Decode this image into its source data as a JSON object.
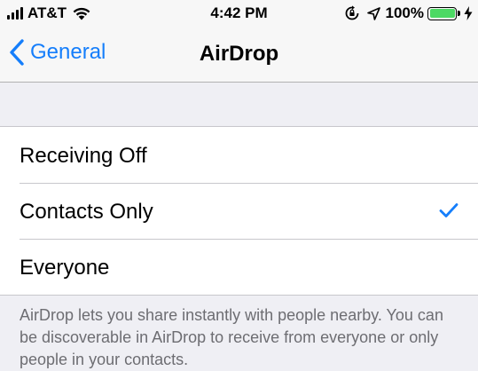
{
  "status_bar": {
    "carrier": "AT&T",
    "time": "4:42 PM",
    "battery_percent": "100%",
    "icons": [
      "signal-bars-icon",
      "wifi-icon",
      "orientation-lock-icon",
      "location-arrow-icon",
      "battery-icon",
      "charging-bolt-icon"
    ],
    "battery_color": "#4cd964"
  },
  "nav": {
    "back_label": "General",
    "title": "AirDrop",
    "accent_color": "#157efb"
  },
  "options": [
    {
      "label": "Receiving Off",
      "selected": false
    },
    {
      "label": "Contacts Only",
      "selected": true
    },
    {
      "label": "Everyone",
      "selected": false
    }
  ],
  "footer": {
    "text": "AirDrop lets you share instantly with people nearby. You can be discoverable in AirDrop to receive from everyone or only people in your contacts."
  }
}
